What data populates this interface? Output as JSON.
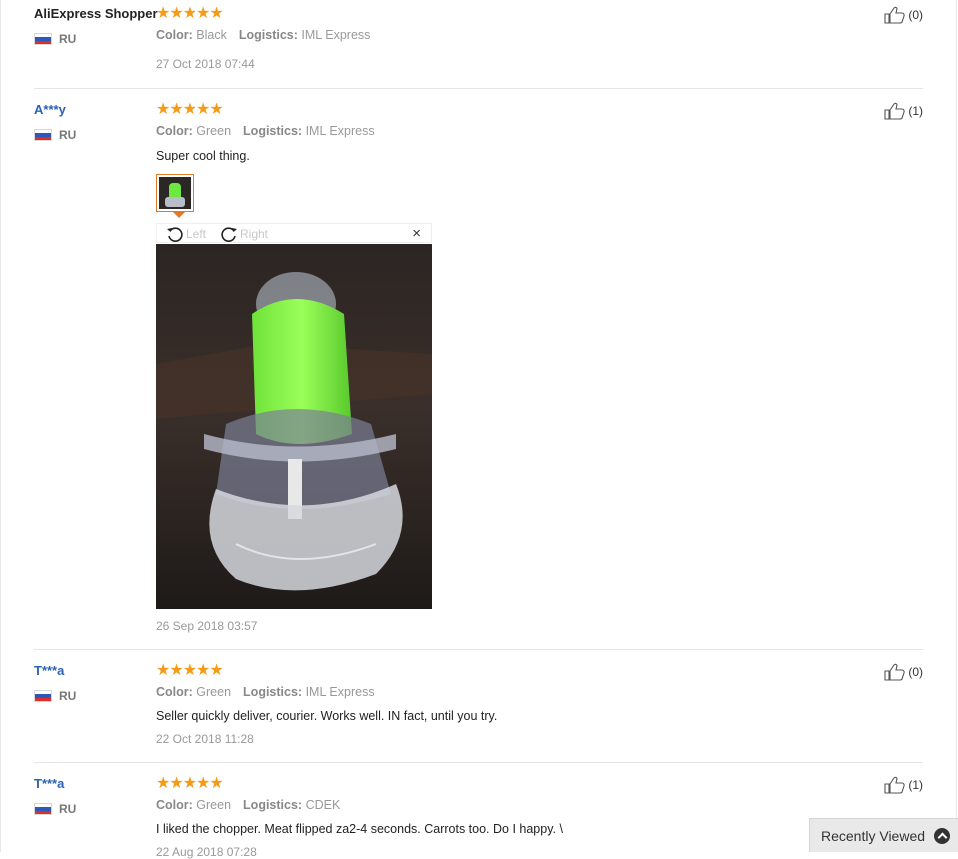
{
  "reviews": [
    {
      "user": "AliExpress Shopper",
      "country": "RU",
      "stars": "★★★★★",
      "color_label": "Color:",
      "color": "Black",
      "logistics_label": "Logistics:",
      "logistics": "IML Express",
      "content": "",
      "date": "27 Oct 2018 07:44",
      "likes": "(0)"
    },
    {
      "user": "A***y",
      "country": "RU",
      "stars": "★★★★★",
      "color_label": "Color:",
      "color": "Green",
      "logistics_label": "Logistics:",
      "logistics": "IML Express",
      "content": "Super cool thing.",
      "date": "26 Sep 2018 03:57",
      "likes": "(1)"
    },
    {
      "user": "T***a",
      "country": "RU",
      "stars": "★★★★★",
      "color_label": "Color:",
      "color": "Green",
      "logistics_label": "Logistics:",
      "logistics": "IML Express",
      "content": "Seller quickly deliver, courier. Works well. IN fact, until you try.",
      "date": "22 Oct 2018 11:28",
      "likes": "(0)"
    },
    {
      "user": "T***a",
      "country": "RU",
      "stars": "★★★★★",
      "color_label": "Color:",
      "color": "Green",
      "logistics_label": "Logistics:",
      "logistics": "CDEK",
      "content": "I liked the chopper. Meat flipped za2-4 seconds. Carrots too. Do I happy. \\",
      "date": "22 Aug 2018 07:28",
      "likes": "(1)"
    }
  ],
  "viewer": {
    "rotate_left": "Left",
    "rotate_right": "Right",
    "close": "×"
  },
  "recently_viewed": "Recently Viewed",
  "icons": {
    "thumbs_up": "thumbs-up-icon",
    "rotate_left": "rotate-left-icon",
    "rotate_right": "rotate-right-icon",
    "close": "close-icon",
    "chevron_up": "chevron-up-icon",
    "flag": "russia-flag-icon"
  },
  "colors": {
    "star": "#f49b18",
    "username": "#2a63b5",
    "thumb_border": "#e07a2b"
  }
}
